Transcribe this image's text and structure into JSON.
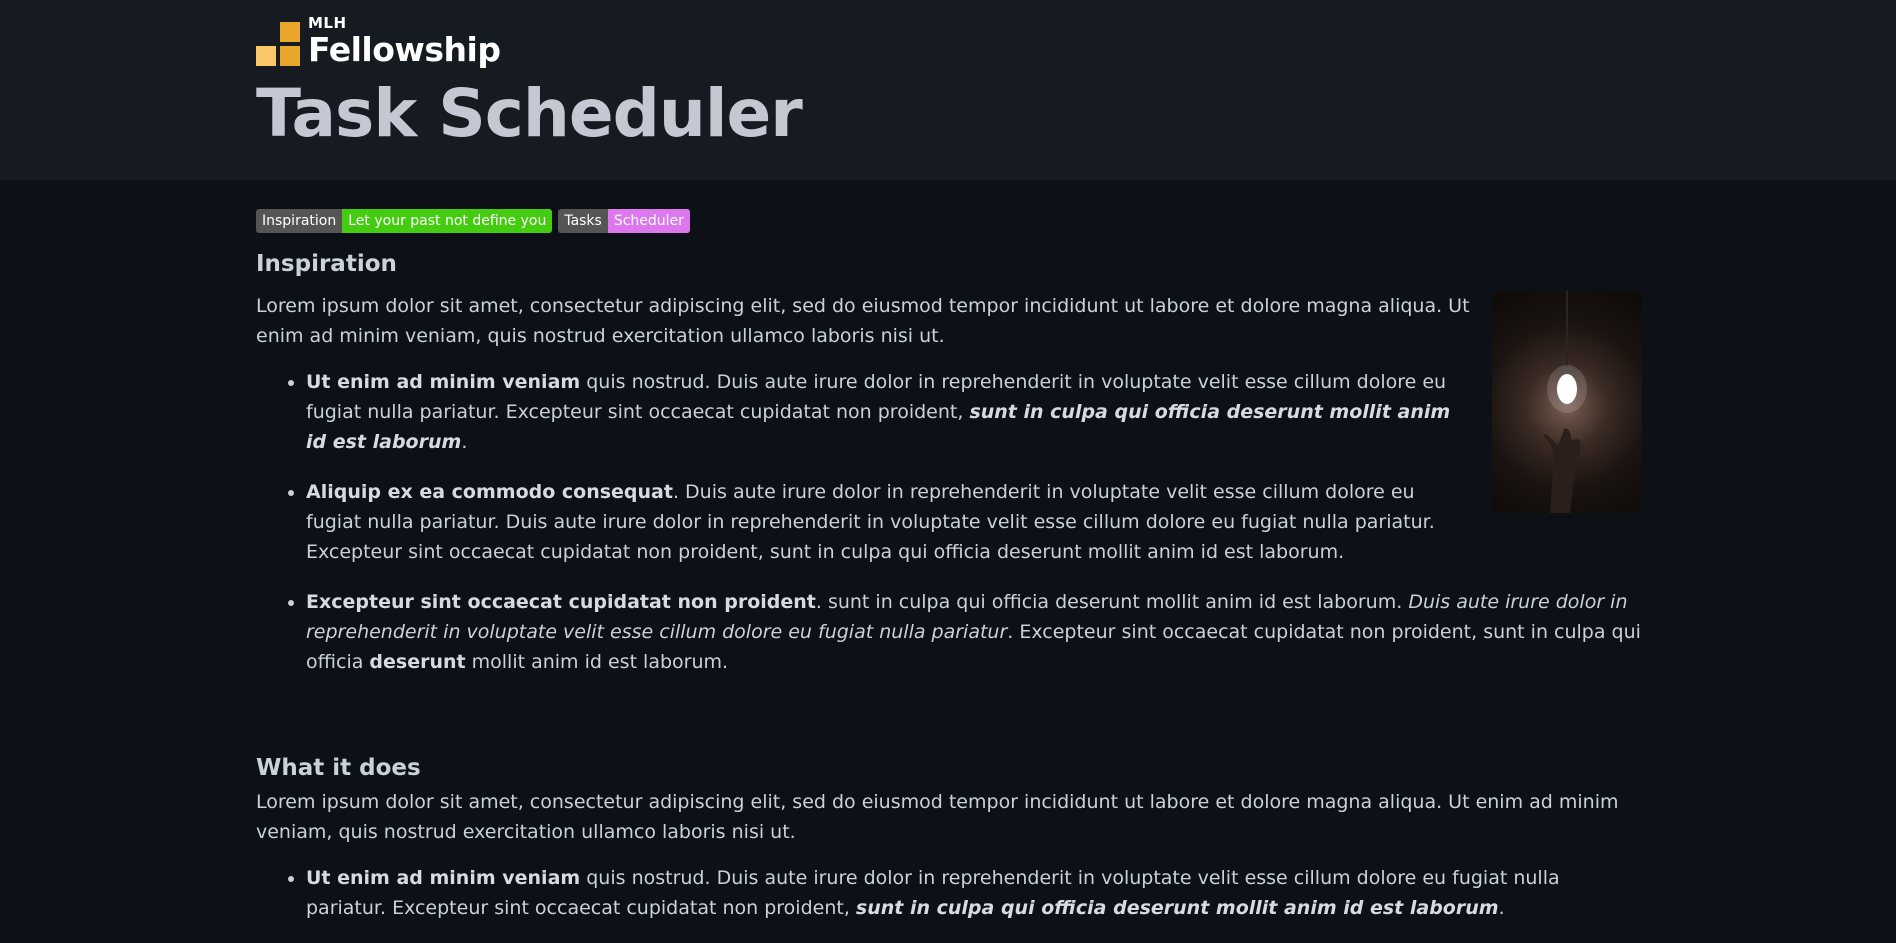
{
  "header": {
    "logo_small": "MLH",
    "logo_big": "Fellowship",
    "title": "Task Scheduler"
  },
  "badges": [
    {
      "key": "Inspiration",
      "value": "Let your past not define you",
      "color": "#44cc11"
    },
    {
      "key": "Tasks",
      "value": "Scheduler",
      "color": "#dd77ee"
    }
  ],
  "section1": {
    "heading": "Inspiration",
    "intro": "Lorem ipsum dolor sit amet, consectetur adipiscing elit, sed do eiusmod tempor incididunt ut labore et dolore magna aliqua. Ut enim ad minim veniam, quis nostrud exercitation ullamco laboris nisi ut.",
    "items": [
      {
        "b1": "Ut enim ad minim veniam",
        "t1": " quis nostrud. Duis aute irure dolor in reprehenderit in voluptate velit esse cillum dolore eu fugiat nulla pariatur. Excepteur sint occaecat cupidatat non proident, ",
        "bi": "sunt in culpa qui officia deserunt mollit anim id est laborum",
        "t2": "."
      },
      {
        "b1": "Aliquip ex ea commodo consequat",
        "t1": ". Duis aute irure dolor in reprehenderit in voluptate velit esse cillum dolore eu fugiat nulla pariatur. Duis aute irure dolor in reprehenderit in voluptate velit esse cillum dolore eu fugiat nulla pariatur. Excepteur sint occaecat cupidatat non proident, sunt in culpa qui officia deserunt mollit anim id est laborum."
      },
      {
        "b1": "Excepteur sint occaecat cupidatat non proident",
        "t1": ". sunt in culpa qui officia deserunt mollit anim id est laborum. ",
        "i1": "Duis aute irure dolor in reprehenderit in voluptate velit esse cillum dolore eu fugiat nulla pariatur",
        "t2": ". Excepteur sint occaecat cupidatat non proident, sunt in culpa qui officia ",
        "b2": "deserunt",
        "t3": " mollit anim id est laborum."
      }
    ]
  },
  "section2": {
    "heading": "What it does",
    "intro": "Lorem ipsum dolor sit amet, consectetur adipiscing elit, sed do eiusmod tempor incididunt ut labore et dolore magna aliqua. Ut enim ad minim veniam, quis nostrud exercitation ullamco laboris nisi ut.",
    "items": [
      {
        "b1": "Ut enim ad minim veniam",
        "t1": " quis nostrud. Duis aute irure dolor in reprehenderit in voluptate velit esse cillum dolore eu fugiat nulla pariatur. Excepteur sint occaecat cupidatat non proident, ",
        "bi": "sunt in culpa qui officia deserunt mollit anim id est laborum",
        "t2": "."
      }
    ]
  }
}
